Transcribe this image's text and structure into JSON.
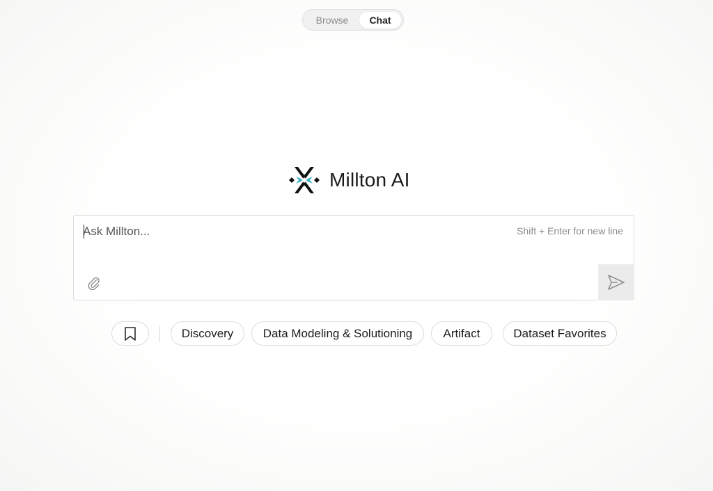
{
  "mode_toggle": {
    "browse_label": "Browse",
    "chat_label": "Chat",
    "active": "Chat"
  },
  "brand": {
    "name": "Millton AI",
    "logo_icon": "snowflake-star-logo",
    "colors": {
      "dark": "#111111",
      "teal": "#43b6c3"
    }
  },
  "chat": {
    "placeholder": "Ask Millton...",
    "value": "",
    "hint": "Shift + Enter for new line",
    "attach_icon": "paperclip-icon",
    "send_icon": "send-icon"
  },
  "shortcuts": {
    "bookmark_icon": "bookmark-icon",
    "items": [
      "Discovery",
      "Data Modeling & Solutioning",
      "Artifact",
      "Dataset Favorites"
    ]
  }
}
